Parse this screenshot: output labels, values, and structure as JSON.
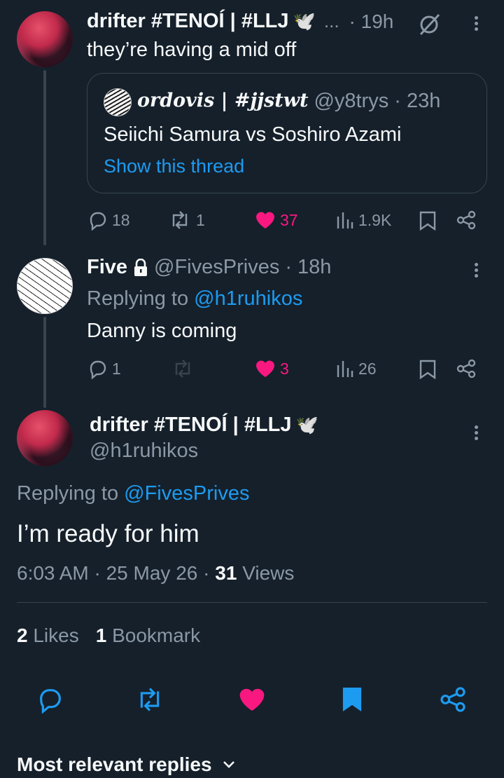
{
  "tweet1": {
    "display_name": "drifter #TENOÍ | #LLJ",
    "name_emoji": "🕊️",
    "truncation": "...",
    "time": "· 19h",
    "text": "they’re having a mid off",
    "quote": {
      "display_name": "ordovis | #jjstwt",
      "handle": "@y8trys",
      "time": "· 23h",
      "text": "Seiichi Samura vs Soshiro Azami",
      "show_thread": "Show this thread"
    },
    "replies": "18",
    "reposts": "1",
    "likes": "37",
    "views": "1.9K"
  },
  "tweet2": {
    "display_name": "Five",
    "handle": "@FivesPrives",
    "time": "· 18h",
    "replying_prefix": "Replying to",
    "replying_to": "@h1ruhikos",
    "text": "Danny is coming",
    "replies": "1",
    "reposts": "",
    "likes": "3",
    "views": "26"
  },
  "main": {
    "display_name": "drifter #TENOÍ | #LLJ",
    "name_emoji": "🕊️",
    "handle": "@h1ruhikos",
    "replying_prefix": "Replying to",
    "replying_to": "@FivesPrives",
    "text": "I’m ready for him",
    "timestamp": "6:03 AM · 25 May 26 ·",
    "views_count": "31",
    "views_label": "Views",
    "likes_count": "2",
    "likes_label": "Likes",
    "bookmarks_count": "1",
    "bookmarks_label": "Bookmark"
  },
  "footer": {
    "sort_label": "Most relevant replies"
  },
  "colors": {
    "background": "#15202b",
    "accent": "#1d9bf0",
    "like": "#f91880",
    "muted": "#8b98a5"
  }
}
